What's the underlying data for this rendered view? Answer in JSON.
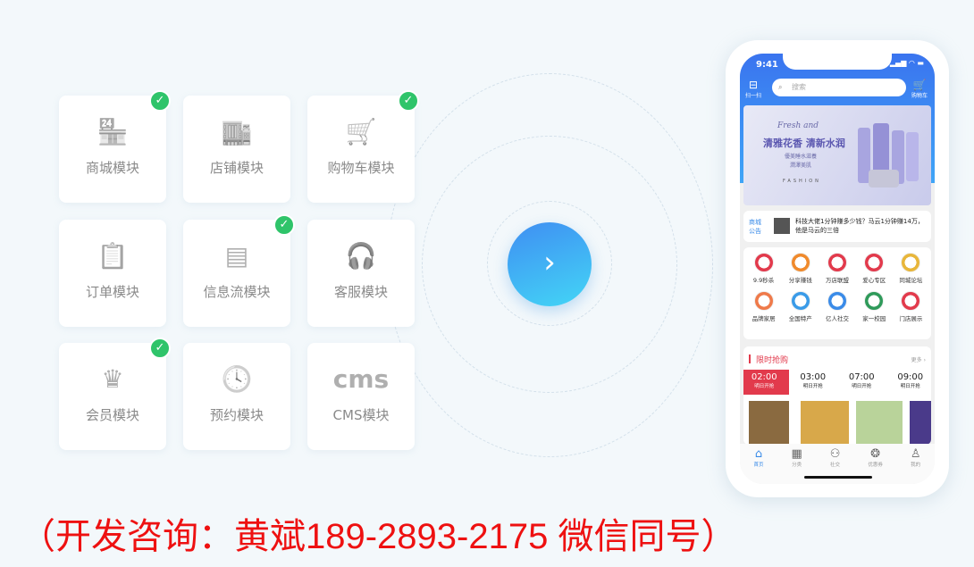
{
  "modules": [
    {
      "label": "商城模块",
      "icon": "store-icon",
      "glyph": "🏪",
      "checked": true
    },
    {
      "label": "店铺模块",
      "icon": "shop-icon",
      "glyph": "🏬",
      "checked": false
    },
    {
      "label": "购物车模块",
      "icon": "cart-icon",
      "glyph": "🛒",
      "checked": true
    },
    {
      "label": "订单模块",
      "icon": "clipboard-icon",
      "glyph": "📋",
      "checked": false
    },
    {
      "label": "信息流模块",
      "icon": "feed-icon",
      "glyph": "▤",
      "checked": true
    },
    {
      "label": "客服模块",
      "icon": "headset-icon",
      "glyph": "🎧",
      "checked": false
    },
    {
      "label": "会员模块",
      "icon": "crown-icon",
      "glyph": "♛",
      "checked": true
    },
    {
      "label": "预约模块",
      "icon": "clock-icon",
      "glyph": "🕓",
      "checked": false
    },
    {
      "label": "CMS模块",
      "icon": "cms-icon",
      "glyph": "cms",
      "checked": false
    }
  ],
  "phone": {
    "time": "9:41",
    "scan": "扫一扫",
    "search_placeholder": "搜索",
    "cart": "购物车",
    "banner": {
      "script": "Fresh and",
      "headline": "清雅花香 清新水润",
      "sub1": "優美睡水滋養",
      "sub2": "潤澤美肌",
      "brand": "FASHION"
    },
    "notice": {
      "tag1": "商城",
      "tag2": "公告",
      "text": "科技大佬1分钟赚多少钱？马云1分钟赚14万，他是马云的三倍"
    },
    "grid": [
      {
        "label": "9.9秒杀",
        "color": "#e23a4c"
      },
      {
        "label": "分享赚钱",
        "color": "#f08a2c"
      },
      {
        "label": "万店联盟",
        "color": "#e23a4c"
      },
      {
        "label": "爱心专区",
        "color": "#e23a4c"
      },
      {
        "label": "同城论坛",
        "color": "#e8b63a"
      },
      {
        "label": "品牌家居",
        "color": "#ef7a4a"
      },
      {
        "label": "全国特产",
        "color": "#3a9be8"
      },
      {
        "label": "亿人社交",
        "color": "#3a8be8"
      },
      {
        "label": "家一校园",
        "color": "#2f9a5a"
      },
      {
        "label": "门店展示",
        "color": "#e23a4c"
      }
    ],
    "flash": {
      "title": "限时抢购",
      "more": "更多",
      "slots": [
        {
          "time": "02:00",
          "label": "明日开抢",
          "active": true
        },
        {
          "time": "03:00",
          "label": "明日开抢"
        },
        {
          "time": "07:00",
          "label": "明日开抢"
        },
        {
          "time": "09:00",
          "label": "明日开抢"
        }
      ]
    },
    "tabs": [
      {
        "label": "首页",
        "icon": "home-icon",
        "glyph": "⌂"
      },
      {
        "label": "分类",
        "icon": "category-icon",
        "glyph": "▦"
      },
      {
        "label": "社交",
        "icon": "social-icon",
        "glyph": "⚇"
      },
      {
        "label": "优惠券",
        "icon": "coupon-icon",
        "glyph": "❂"
      },
      {
        "label": "我的",
        "icon": "user-icon",
        "glyph": "♙"
      }
    ]
  },
  "footer": "（开发咨询：黄斌189-2893-2175 微信同号）",
  "colors": {
    "check": "#2fc46a",
    "accent": "#3a74ef",
    "red": "#ee1111"
  }
}
